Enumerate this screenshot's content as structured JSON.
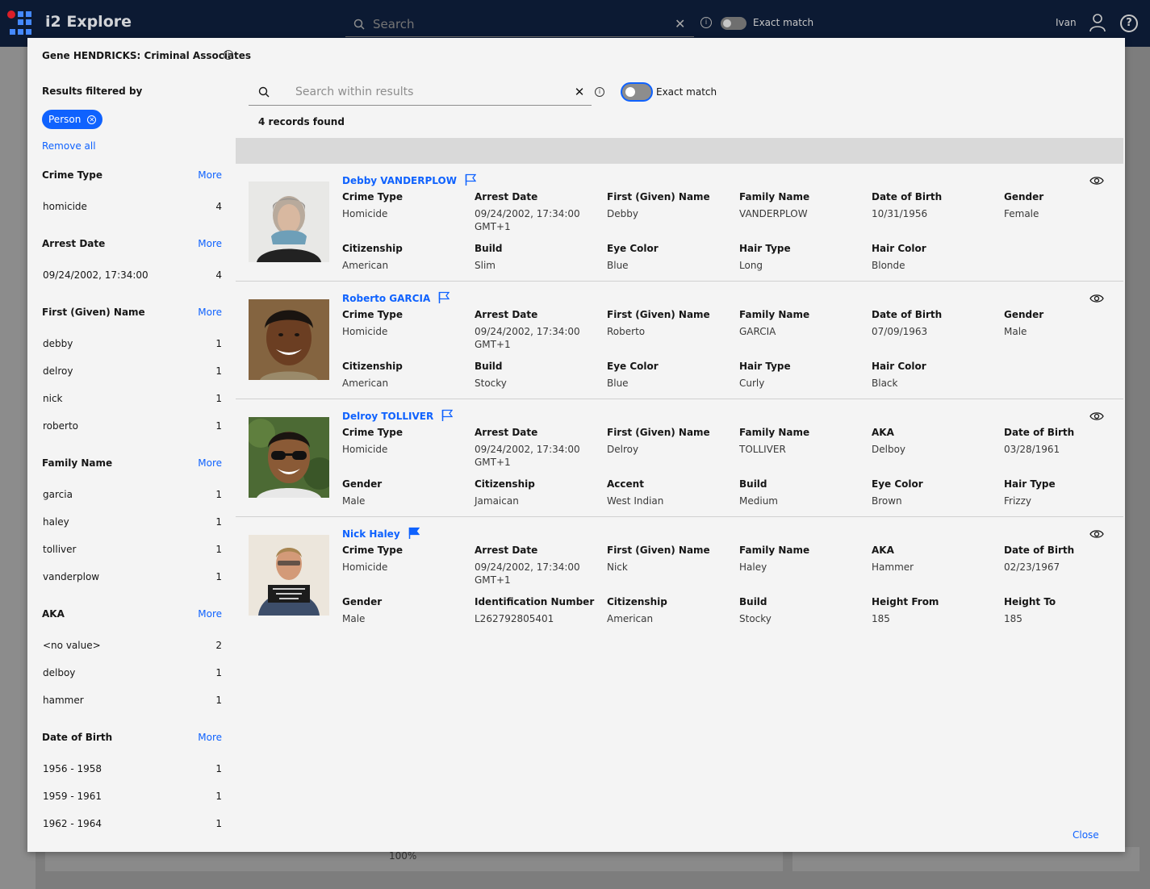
{
  "topbar": {
    "app_title": "i2 Explore",
    "search_placeholder": "Search",
    "exact_match": "Exact match",
    "user": "Ivan"
  },
  "background": {
    "zoom": "100%"
  },
  "modal": {
    "title": "Gene HENDRICKS: Criminal Associates",
    "close": "Close"
  },
  "sidebar": {
    "filtered_by": "Results filtered by",
    "chip": "Person",
    "remove_all": "Remove all",
    "more_label": "More",
    "facets": [
      {
        "name": "Crime Type",
        "items": [
          {
            "v": "homicide",
            "c": "4"
          }
        ]
      },
      {
        "name": "Arrest Date",
        "items": [
          {
            "v": "09/24/2002, 17:34:00",
            "c": "4"
          }
        ]
      },
      {
        "name": "First (Given) Name",
        "items": [
          {
            "v": "debby",
            "c": "1"
          },
          {
            "v": "delroy",
            "c": "1"
          },
          {
            "v": "nick",
            "c": "1"
          },
          {
            "v": "roberto",
            "c": "1"
          }
        ]
      },
      {
        "name": "Family Name",
        "items": [
          {
            "v": "garcia",
            "c": "1"
          },
          {
            "v": "haley",
            "c": "1"
          },
          {
            "v": "tolliver",
            "c": "1"
          },
          {
            "v": "vanderplow",
            "c": "1"
          }
        ]
      },
      {
        "name": "AKA",
        "items": [
          {
            "v": "<no value>",
            "c": "2"
          },
          {
            "v": "delboy",
            "c": "1"
          },
          {
            "v": "hammer",
            "c": "1"
          }
        ]
      },
      {
        "name": "Date of Birth",
        "items": [
          {
            "v": "1956 - 1958",
            "c": "1"
          },
          {
            "v": "1959 - 1961",
            "c": "1"
          },
          {
            "v": "1962 - 1964",
            "c": "1"
          }
        ]
      }
    ]
  },
  "results_search": {
    "placeholder": "Search within results",
    "exact_match": "Exact match",
    "records_found": "4 records found"
  },
  "results": [
    {
      "name": "Debby VANDERPLOW",
      "flag_filled": false,
      "photo": "woman-grey-hair",
      "fields": [
        {
          "l": "Crime Type",
          "v": "Homicide"
        },
        {
          "l": "Arrest Date",
          "v": "09/24/2002, 17:34:00 GMT+1"
        },
        {
          "l": "First (Given) Name",
          "v": "Debby"
        },
        {
          "l": "Family Name",
          "v": "VANDERPLOW"
        },
        {
          "l": "Date of Birth",
          "v": "10/31/1956"
        },
        {
          "l": "Gender",
          "v": "Female"
        },
        {
          "l": "Citizenship",
          "v": "American"
        },
        {
          "l": "Build",
          "v": "Slim"
        },
        {
          "l": "Eye Color",
          "v": "Blue"
        },
        {
          "l": "Hair Type",
          "v": "Long"
        },
        {
          "l": "Hair Color",
          "v": "Blonde"
        }
      ]
    },
    {
      "name": "Roberto GARCIA",
      "flag_filled": false,
      "photo": "man-smiling",
      "fields": [
        {
          "l": "Crime Type",
          "v": "Homicide"
        },
        {
          "l": "Arrest Date",
          "v": "09/24/2002, 17:34:00 GMT+1"
        },
        {
          "l": "First (Given) Name",
          "v": "Roberto"
        },
        {
          "l": "Family Name",
          "v": "GARCIA"
        },
        {
          "l": "Date of Birth",
          "v": "07/09/1963"
        },
        {
          "l": "Gender",
          "v": "Male"
        },
        {
          "l": "Citizenship",
          "v": "American"
        },
        {
          "l": "Build",
          "v": "Stocky"
        },
        {
          "l": "Eye Color",
          "v": "Blue"
        },
        {
          "l": "Hair Type",
          "v": "Curly"
        },
        {
          "l": "Hair Color",
          "v": "Black"
        }
      ]
    },
    {
      "name": "Delroy TOLLIVER",
      "flag_filled": false,
      "photo": "man-sunglasses",
      "fields": [
        {
          "l": "Crime Type",
          "v": "Homicide"
        },
        {
          "l": "Arrest Date",
          "v": "09/24/2002, 17:34:00 GMT+1"
        },
        {
          "l": "First (Given) Name",
          "v": "Delroy"
        },
        {
          "l": "Family Name",
          "v": "TOLLIVER"
        },
        {
          "l": "AKA",
          "v": "Delboy"
        },
        {
          "l": "Date of Birth",
          "v": "03/28/1961"
        },
        {
          "l": "Gender",
          "v": "Male"
        },
        {
          "l": "Citizenship",
          "v": "Jamaican"
        },
        {
          "l": "Accent",
          "v": "West Indian"
        },
        {
          "l": "Build",
          "v": "Medium"
        },
        {
          "l": "Eye Color",
          "v": "Brown"
        },
        {
          "l": "Hair Type",
          "v": "Frizzy"
        }
      ]
    },
    {
      "name": "Nick Haley",
      "flag_filled": true,
      "photo": "man-mugshot",
      "fields": [
        {
          "l": "Crime Type",
          "v": "Homicide"
        },
        {
          "l": "Arrest Date",
          "v": "09/24/2002, 17:34:00 GMT+1"
        },
        {
          "l": "First (Given) Name",
          "v": "Nick"
        },
        {
          "l": "Family Name",
          "v": "Haley"
        },
        {
          "l": "AKA",
          "v": "Hammer"
        },
        {
          "l": "Date of Birth",
          "v": "02/23/1967"
        },
        {
          "l": "Gender",
          "v": "Male"
        },
        {
          "l": "Identification Number",
          "v": "L262792805401"
        },
        {
          "l": "Citizenship",
          "v": "American"
        },
        {
          "l": "Build",
          "v": "Stocky"
        },
        {
          "l": "Height From",
          "v": "185"
        },
        {
          "l": "Height To",
          "v": "185"
        }
      ]
    }
  ],
  "colors": {
    "accent": "#0f62fe",
    "topbar": "#0c1a33",
    "modal_bg": "#f4f4f4"
  }
}
